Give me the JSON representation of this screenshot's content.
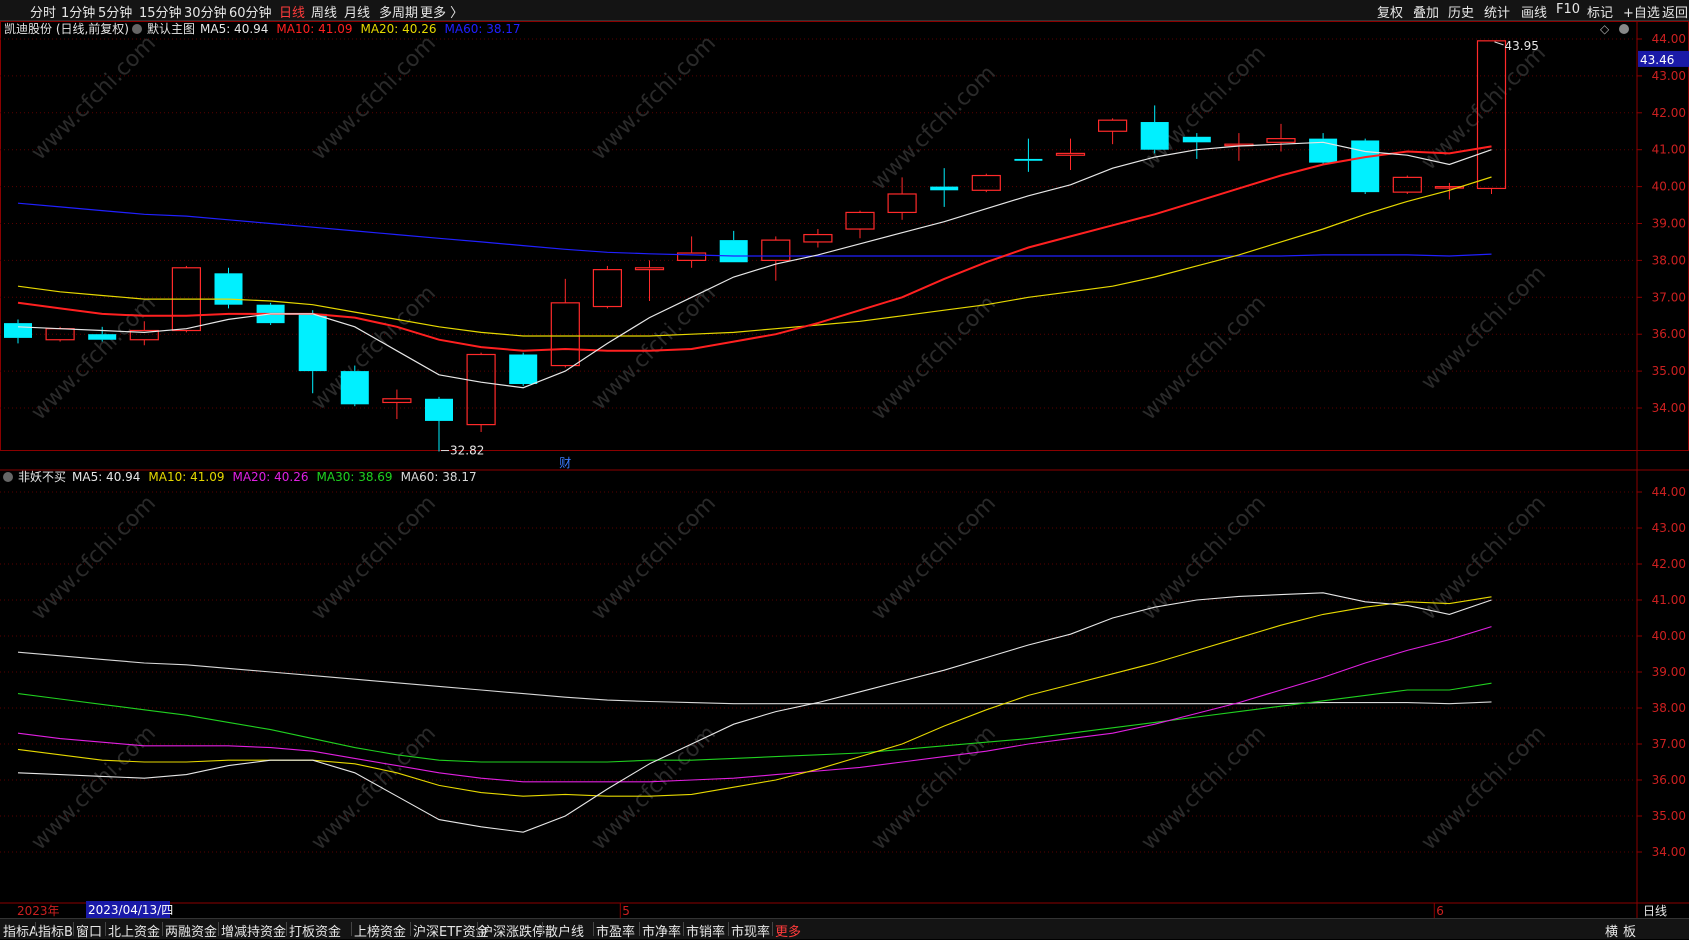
{
  "toolbar": {
    "periods": [
      "分时",
      "1分钟",
      "5分钟",
      "15分钟",
      "30分钟",
      "60分钟",
      "日线",
      "周线",
      "月线",
      "多周期",
      "更多 〉"
    ],
    "active_period": "日线",
    "right": [
      "复权",
      "叠加",
      "历史",
      "统计",
      "画线",
      "F10",
      "标记",
      "+自选",
      "返回"
    ]
  },
  "main_panel": {
    "stock": "凯迪股份 (日线,前复权)",
    "indicator": "默认主图",
    "ma_legend": [
      {
        "label": "MA5: 40.94",
        "color": "#e6e6e6"
      },
      {
        "label": "MA10: 41.09",
        "color": "#ff2020"
      },
      {
        "label": "MA20: 40.26",
        "color": "#e6d800"
      },
      {
        "label": "MA60: 38.17",
        "color": "#2020ff"
      }
    ],
    "price_ticks": [
      "44.00",
      "43.00",
      "42.00",
      "41.00",
      "40.00",
      "39.00",
      "38.00",
      "37.00",
      "36.00",
      "35.00",
      "34.00"
    ],
    "current_price": "43.46",
    "high_label": "43.95",
    "low_label": "32.82",
    "event_marker": "财"
  },
  "sub_panel": {
    "indicator": "非妖不买",
    "ma_legend": [
      {
        "label": "MA5: 40.94",
        "color": "#e6e6e6"
      },
      {
        "label": "MA10: 41.09",
        "color": "#e6d800"
      },
      {
        "label": "MA20: 40.26",
        "color": "#e020e0"
      },
      {
        "label": "MA30: 38.69",
        "color": "#20d020"
      },
      {
        "label": "MA60: 38.17",
        "color": "#d8d8d8"
      }
    ],
    "price_ticks": [
      "44.00",
      "43.00",
      "42.00",
      "41.00",
      "40.00",
      "39.00",
      "38.00",
      "37.00",
      "36.00",
      "35.00",
      "34.00"
    ]
  },
  "time_axis": {
    "year": "2023年",
    "cursor_date": "2023/04/13/四",
    "month_labels": [
      "5",
      "6"
    ],
    "period_label": "日线"
  },
  "watermark": "www.cfchi.com",
  "bottom_tabs": [
    "指标A",
    "指标B",
    "窗口",
    "北上资金",
    "两融资金",
    "增减持资金",
    "打板资金",
    "上榜资金",
    "沪深ETF资金",
    "沪深涨跌停",
    "散户线",
    "市盈率",
    "市净率",
    "市销率",
    "市现率",
    "更多"
  ],
  "bottom_right": [
    "横",
    "板"
  ],
  "chart_data": {
    "type": "candlestick",
    "colors": {
      "up": "#ff2a2a",
      "down": "#00f0ff",
      "ma5": "#e6e6e6",
      "ma10": "#ff2020",
      "ma20": "#e6d800",
      "ma60": "#2020ff"
    },
    "ylim": [
      33.1,
      44.1
    ],
    "candles": [
      {
        "o": 36.3,
        "c": 35.9,
        "h": 36.4,
        "l": 35.75
      },
      {
        "o": 35.85,
        "c": 36.15,
        "h": 36.2,
        "l": 35.8
      },
      {
        "o": 36.0,
        "c": 35.85,
        "h": 36.2,
        "l": 35.8
      },
      {
        "o": 35.85,
        "c": 36.1,
        "h": 36.35,
        "l": 35.7
      },
      {
        "o": 36.1,
        "c": 37.8,
        "h": 37.85,
        "l": 36.05
      },
      {
        "o": 37.65,
        "c": 36.8,
        "h": 37.8,
        "l": 36.7
      },
      {
        "o": 36.8,
        "c": 36.3,
        "h": 36.85,
        "l": 36.25
      },
      {
        "o": 36.55,
        "c": 35.0,
        "h": 36.65,
        "l": 34.4
      },
      {
        "o": 35.0,
        "c": 34.1,
        "h": 35.15,
        "l": 34.05
      },
      {
        "o": 34.15,
        "c": 34.25,
        "h": 34.5,
        "l": 33.7
      },
      {
        "o": 34.25,
        "c": 33.65,
        "h": 34.3,
        "l": 32.82
      },
      {
        "o": 33.55,
        "c": 35.45,
        "h": 35.5,
        "l": 33.35
      },
      {
        "o": 35.45,
        "c": 34.65,
        "h": 35.5,
        "l": 34.6
      },
      {
        "o": 35.15,
        "c": 36.85,
        "h": 37.5,
        "l": 35.1
      },
      {
        "o": 36.75,
        "c": 37.75,
        "h": 37.85,
        "l": 36.7
      },
      {
        "o": 37.75,
        "c": 37.8,
        "h": 38.0,
        "l": 36.9
      },
      {
        "o": 38.0,
        "c": 38.2,
        "h": 38.65,
        "l": 37.8
      },
      {
        "o": 38.55,
        "c": 37.95,
        "h": 38.8,
        "l": 37.95
      },
      {
        "o": 38.0,
        "c": 38.55,
        "h": 38.65,
        "l": 37.45
      },
      {
        "o": 38.5,
        "c": 38.7,
        "h": 38.85,
        "l": 38.35
      },
      {
        "o": 38.85,
        "c": 39.3,
        "h": 39.35,
        "l": 38.6
      },
      {
        "o": 39.3,
        "c": 39.8,
        "h": 40.25,
        "l": 39.1
      },
      {
        "o": 40.0,
        "c": 39.9,
        "h": 40.5,
        "l": 39.45
      },
      {
        "o": 39.9,
        "c": 40.3,
        "h": 40.35,
        "l": 39.85
      },
      {
        "o": 40.75,
        "c": 40.7,
        "h": 41.3,
        "l": 40.4
      },
      {
        "o": 40.85,
        "c": 40.9,
        "h": 41.3,
        "l": 40.45
      },
      {
        "o": 41.5,
        "c": 41.8,
        "h": 41.85,
        "l": 41.15
      },
      {
        "o": 41.75,
        "c": 41.0,
        "h": 42.2,
        "l": 40.9
      },
      {
        "o": 41.35,
        "c": 41.2,
        "h": 41.45,
        "l": 40.75
      },
      {
        "o": 41.15,
        "c": 41.15,
        "h": 41.45,
        "l": 40.7
      },
      {
        "o": 41.2,
        "c": 41.3,
        "h": 41.7,
        "l": 40.95
      },
      {
        "o": 41.3,
        "c": 40.65,
        "h": 41.45,
        "l": 40.6
      },
      {
        "o": 41.25,
        "c": 39.85,
        "h": 41.3,
        "l": 39.8
      },
      {
        "o": 39.85,
        "c": 40.25,
        "h": 40.3,
        "l": 39.8
      },
      {
        "o": 40.0,
        "c": 40.0,
        "h": 40.1,
        "l": 39.65
      },
      {
        "o": 39.95,
        "c": 43.95,
        "h": 43.95,
        "l": 39.8
      }
    ],
    "ma5": [
      36.2,
      36.15,
      36.1,
      36.05,
      36.15,
      36.4,
      36.55,
      36.55,
      36.2,
      35.55,
      34.9,
      34.7,
      34.55,
      35.0,
      35.75,
      36.45,
      37.0,
      37.55,
      37.9,
      38.15,
      38.45,
      38.75,
      39.05,
      39.4,
      39.75,
      40.05,
      40.5,
      40.8,
      41.0,
      41.1,
      41.15,
      41.2,
      40.95,
      40.85,
      40.6,
      41.0
    ],
    "ma10": [
      36.85,
      36.7,
      36.55,
      36.5,
      36.5,
      36.55,
      36.55,
      36.55,
      36.45,
      36.2,
      35.85,
      35.65,
      35.55,
      35.6,
      35.55,
      35.55,
      35.6,
      35.8,
      36.0,
      36.3,
      36.65,
      37.0,
      37.5,
      37.95,
      38.35,
      38.65,
      38.95,
      39.25,
      39.6,
      39.95,
      40.3,
      40.6,
      40.8,
      40.95,
      40.9,
      41.09
    ],
    "ma20": [
      37.3,
      37.15,
      37.05,
      36.95,
      36.95,
      36.95,
      36.9,
      36.8,
      36.6,
      36.4,
      36.2,
      36.05,
      35.95,
      35.95,
      35.95,
      35.95,
      36.0,
      36.05,
      36.15,
      36.25,
      36.35,
      36.5,
      36.65,
      36.8,
      37.0,
      37.15,
      37.3,
      37.55,
      37.85,
      38.15,
      38.5,
      38.85,
      39.25,
      39.6,
      39.9,
      40.26
    ],
    "ma30": [
      38.4,
      38.25,
      38.1,
      37.95,
      37.8,
      37.6,
      37.4,
      37.15,
      36.9,
      36.7,
      36.55,
      36.5,
      36.5,
      36.5,
      36.5,
      36.55,
      36.55,
      36.6,
      36.65,
      36.7,
      36.75,
      36.85,
      36.95,
      37.05,
      37.15,
      37.3,
      37.45,
      37.6,
      37.75,
      37.9,
      38.05,
      38.2,
      38.35,
      38.5,
      38.5,
      38.69
    ],
    "ma60": [
      39.55,
      39.45,
      39.35,
      39.25,
      39.2,
      39.1,
      39.0,
      38.9,
      38.8,
      38.7,
      38.6,
      38.5,
      38.4,
      38.3,
      38.22,
      38.18,
      38.15,
      38.12,
      38.12,
      38.12,
      38.12,
      38.12,
      38.12,
      38.12,
      38.12,
      38.12,
      38.12,
      38.12,
      38.12,
      38.12,
      38.12,
      38.15,
      38.15,
      38.15,
      38.12,
      38.17
    ]
  }
}
